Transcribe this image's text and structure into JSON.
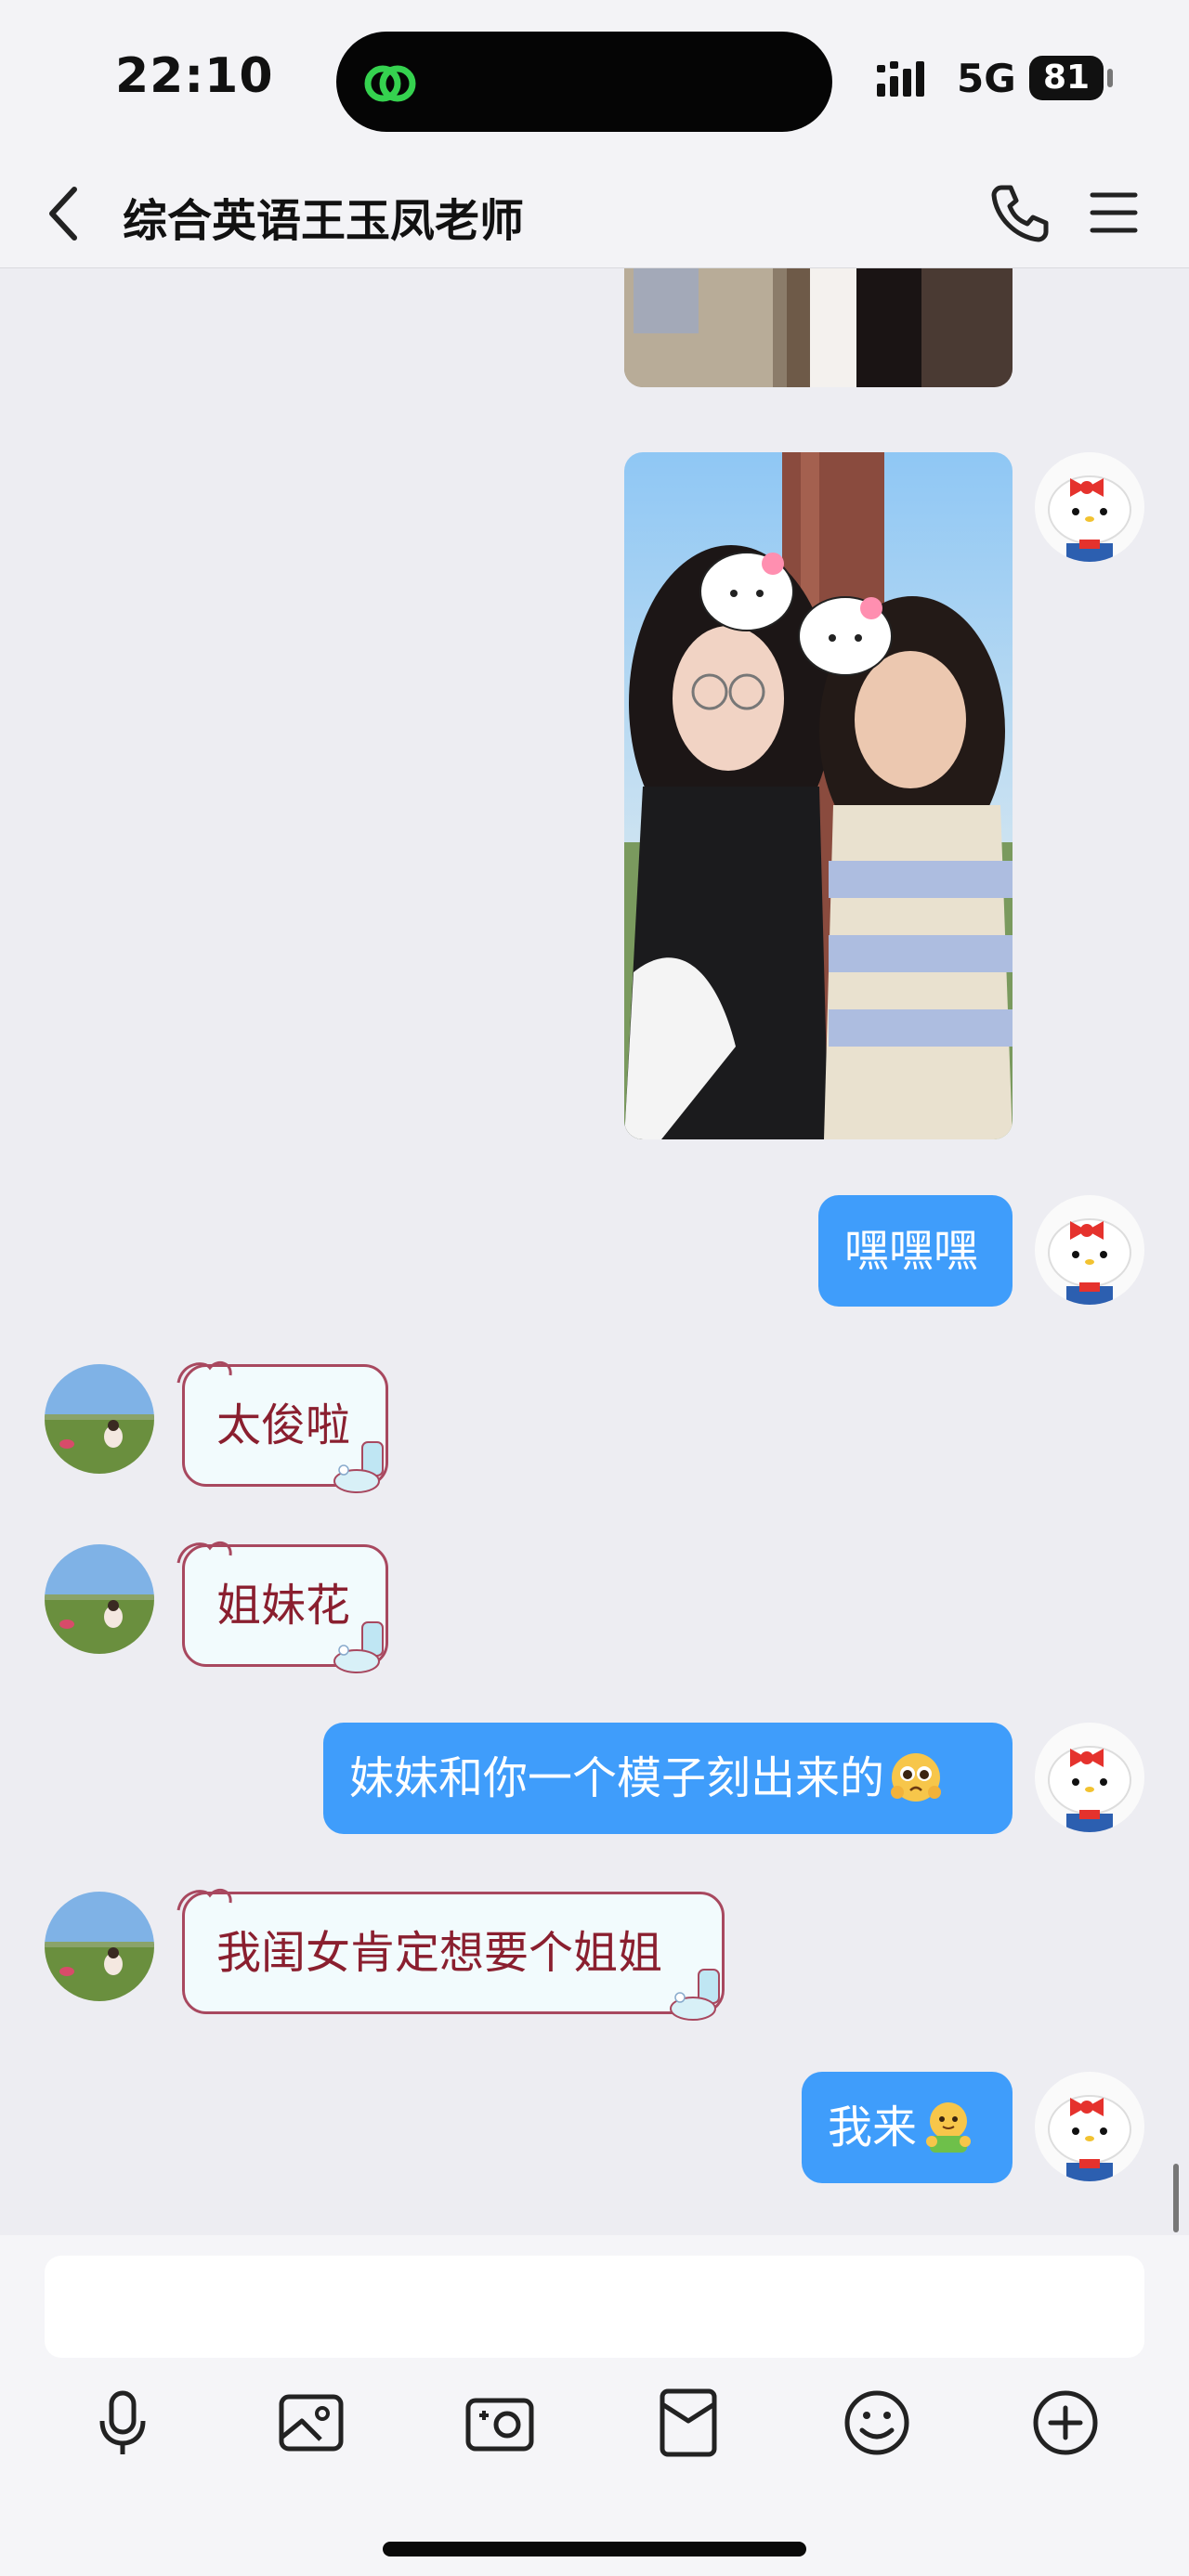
{
  "status_bar": {
    "time": "22:10",
    "network": "5G",
    "battery": "81"
  },
  "header": {
    "title": "综合英语王玉凤老师"
  },
  "messages": [
    {
      "from": "me",
      "type": "image"
    },
    {
      "from": "me",
      "type": "image"
    },
    {
      "from": "me",
      "text": "嘿嘿嘿"
    },
    {
      "from": "them",
      "text": "太俊啦"
    },
    {
      "from": "them",
      "text": "姐妹花"
    },
    {
      "from": "me",
      "text": "妹妹和你一个模子刻出来的",
      "emoji": "pleading-face"
    },
    {
      "from": "them",
      "text": "我闺女肯定想要个姐姐"
    },
    {
      "from": "me",
      "text": "我来",
      "emoji": "hugging-face"
    }
  ],
  "input": {
    "placeholder": ""
  },
  "toolbar": [
    "microphone-icon",
    "image-icon",
    "camera-icon",
    "red-envelope-icon",
    "emoji-icon",
    "plus-icon"
  ],
  "colors": {
    "my_bubble": "#3f9dfb",
    "their_bubble_border": "#a8485f",
    "their_bubble_text": "#8a1f2f",
    "chat_bg": "#ededf2"
  }
}
